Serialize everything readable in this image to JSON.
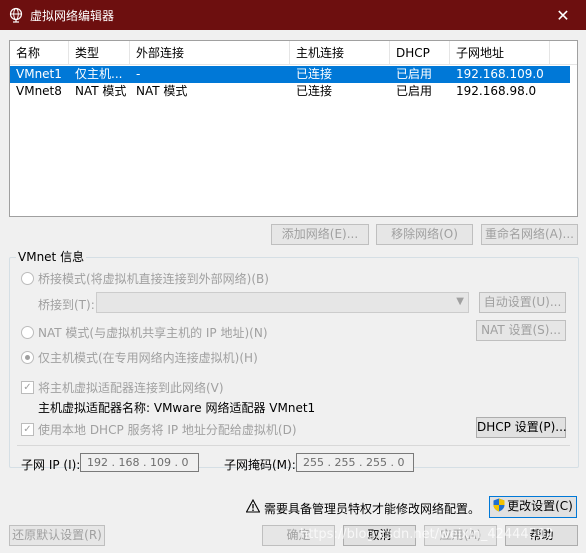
{
  "window": {
    "title": "虚拟网络编辑器",
    "close_label": "✕"
  },
  "table": {
    "columns": [
      "名称",
      "类型",
      "外部连接",
      "主机连接",
      "DHCP",
      "子网地址"
    ],
    "rows": [
      [
        "VMnet1",
        "仅主机...",
        "-",
        "已连接",
        "已启用",
        "192.168.109.0"
      ],
      [
        "VMnet8",
        "NAT 模式",
        "NAT 模式",
        "已连接",
        "已启用",
        "192.168.98.0"
      ]
    ]
  },
  "list_buttons": {
    "add": "添加网络(E)...",
    "remove": "移除网络(O)",
    "rename": "重命名网络(A)..."
  },
  "vmnet_info": {
    "label": "VMnet 信息",
    "bridged": "桥接模式(将虚拟机直接连接到外部网络)(B)",
    "bridged_to": "桥接到(T):",
    "auto_settings": "自动设置(U)...",
    "nat": "NAT 模式(与虚拟机共享主机的 IP 地址)(N)",
    "nat_settings": "NAT 设置(S)...",
    "host_only": "仅主机模式(在专用网络内连接虚拟机)(H)",
    "connect_adapter": "将主机虚拟适配器连接到此网络(V)",
    "adapter_name_label": "主机虚拟适配器名称: VMware 网络适配器 VMnet1",
    "use_dhcp": "使用本地 DHCP 服务将 IP 地址分配给虚拟机(D)",
    "dhcp_settings": "DHCP 设置(P)...",
    "subnet_ip_label": "子网 IP (I):",
    "subnet_ip": "192 . 168 . 109 .  0",
    "subnet_mask_label": "子网掩码(M):",
    "subnet_mask": "255 . 255 . 255 .  0"
  },
  "admin_notice": "需要具备管理员特权才能修改网络配置。",
  "change_settings": "更改设置(C)",
  "bottom_buttons": {
    "restore": "还原默认设置(R)",
    "ok": "确定",
    "cancel": "取消",
    "apply": "应用(A)",
    "help": "帮助"
  },
  "watermark": "https://blog.csdn.net/weixin_42444502",
  "colors": {
    "titlebar": "#6d0f0f",
    "selection": "#0078d7",
    "disabled_text": "#a0a0a0"
  }
}
